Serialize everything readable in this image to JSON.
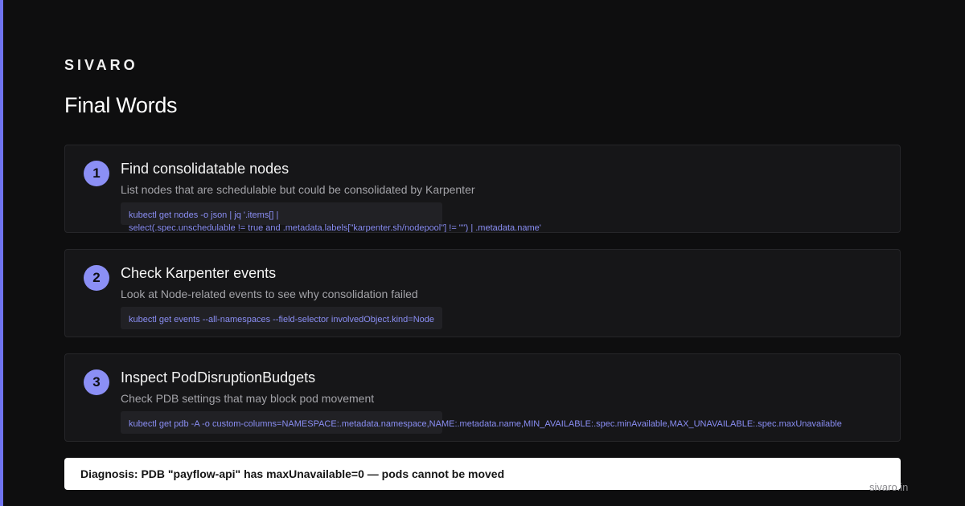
{
  "brand": "SIVARO",
  "title": "Final Words",
  "steps": [
    {
      "number": "1",
      "title": "Find consolidatable nodes",
      "description": "List nodes that are schedulable but could be consolidated by Karpenter",
      "code": "kubectl get nodes -o json | jq '.items[] |\nselect(.spec.unschedulable != true and .metadata.labels[\"karpenter.sh/nodepool\"] != \"\") | .metadata.name'"
    },
    {
      "number": "2",
      "title": "Check Karpenter events",
      "description": "Look at Node-related events to see why consolidation failed",
      "code": "kubectl get events --all-namespaces --field-selector involvedObject.kind=Node"
    },
    {
      "number": "3",
      "title": "Inspect PodDisruptionBudgets",
      "description": "Check PDB settings that may block pod movement",
      "code": "kubectl get pdb -A -o custom-columns=NAMESPACE:.metadata.namespace,NAME:.metadata.name,MIN_AVAILABLE:.spec.minAvailable,MAX_UNAVAILABLE:.spec.maxUnavailable"
    }
  ],
  "diagnosis": "Diagnosis: PDB \"payflow-api\" has maxUnavailable=0 — pods cannot be moved",
  "footer": "sivaro.in",
  "colors": {
    "accent": "#6f73f0",
    "step_badge": "#8b8ff5",
    "code_text": "#8a8ef4",
    "background": "#0e0e0f",
    "card": "#161618"
  }
}
